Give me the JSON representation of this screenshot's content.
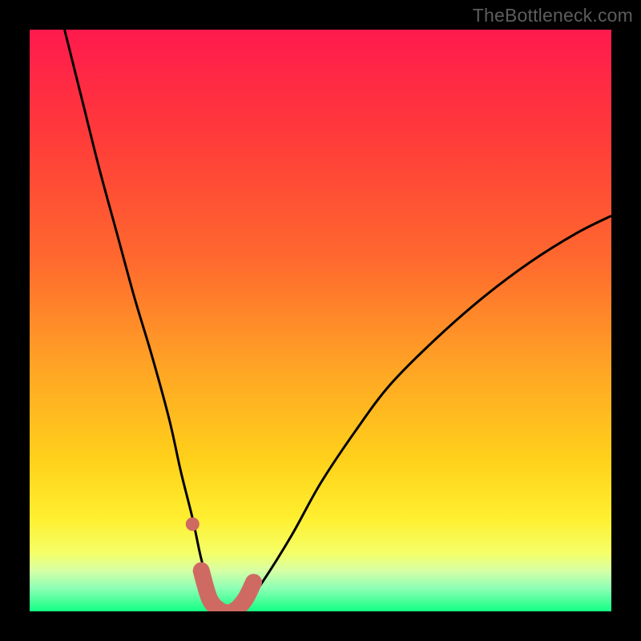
{
  "watermark": "TheBottleneck.com",
  "gradient": {
    "g0": "#ff1a4d",
    "g1": "#ff3a3a",
    "g2": "#ff6a2e",
    "g3": "#ffa425",
    "g4": "#ffd11a",
    "g5": "#ffef30",
    "g6": "#f5ff68",
    "g7": "#d7ffa5",
    "g8": "#8dffb4",
    "g9": "#13ff84"
  },
  "colors": {
    "curve": "#000000",
    "marker_fill": "#cf6a62",
    "marker_stroke": "#cf6a62",
    "frame": "#000000"
  },
  "chart_data": {
    "type": "line",
    "title": "",
    "xlabel": "",
    "ylabel": "",
    "xlim": [
      0,
      100
    ],
    "ylim": [
      0,
      100
    ],
    "series": [
      {
        "name": "bottleneck-curve",
        "x": [
          6,
          9,
          12,
          15,
          18,
          21,
          24,
          26,
          28,
          29.5,
          31,
          33,
          35,
          37,
          40,
          45,
          50,
          56,
          62,
          70,
          78,
          86,
          94,
          100
        ],
        "values": [
          100,
          88,
          76,
          65,
          54,
          44,
          33,
          24,
          16,
          9,
          4,
          0,
          0,
          1,
          5,
          13,
          22,
          31,
          39,
          47,
          54,
          60,
          65,
          68
        ]
      }
    ],
    "markers": [
      {
        "name": "left-dot",
        "x": 28.0,
        "y": 15
      },
      {
        "name": "trough-start",
        "x": 29.5,
        "y": 7
      },
      {
        "name": "trough-left",
        "x": 31.0,
        "y": 2
      },
      {
        "name": "trough-mid-1",
        "x": 33.0,
        "y": 0
      },
      {
        "name": "trough-mid-2",
        "x": 35.0,
        "y": 0
      },
      {
        "name": "trough-right",
        "x": 37.0,
        "y": 2
      },
      {
        "name": "trough-end",
        "x": 38.5,
        "y": 5
      }
    ]
  }
}
